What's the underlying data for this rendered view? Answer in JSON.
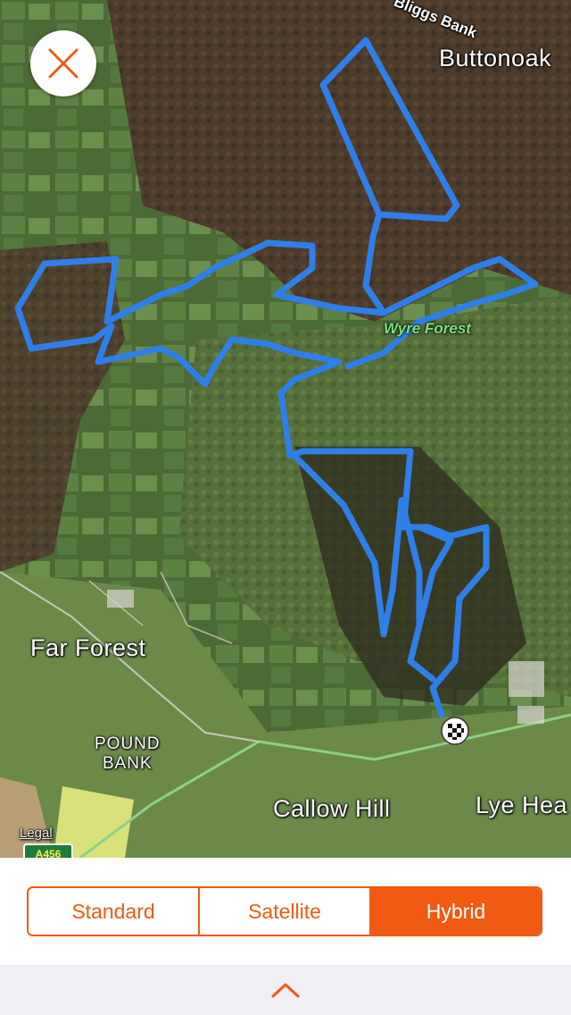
{
  "map": {
    "type": "hybrid satellite",
    "route_color": "#2f7fe8",
    "labels": {
      "buttonoak": "Buttonoak",
      "road_top": "Bliggs Bank",
      "wyre_forest": "Wyre Forest",
      "far_forest": "Far Forest",
      "pound": "POUND",
      "bank": "BANK",
      "callow_hill": "Callow Hill",
      "lye_head": "Lye Hea"
    },
    "road_badge": "A456",
    "legal": "Legal"
  },
  "controls": {
    "close_icon": "close-icon",
    "map_types": [
      {
        "label": "Standard",
        "active": false
      },
      {
        "label": "Satellite",
        "active": false
      },
      {
        "label": "Hybrid",
        "active": true
      }
    ],
    "accent": "#f05a12",
    "expand_icon": "chevron-up-icon"
  }
}
